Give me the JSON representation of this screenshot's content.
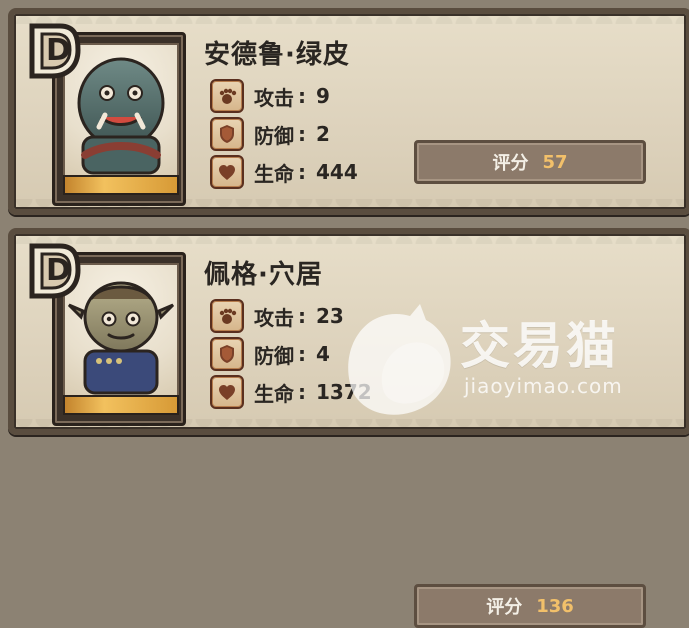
{
  "units": [
    {
      "rank": "D",
      "name": "安德鲁·绿皮",
      "stats": [
        {
          "icon": "paw-icon",
          "label": "攻击",
          "value": "9"
        },
        {
          "icon": "shield-icon",
          "label": "防御",
          "value": "2"
        },
        {
          "icon": "heart-icon",
          "label": "生命",
          "value": "444"
        }
      ],
      "score_label": "评分",
      "score_value": "57",
      "portrait_fill": 1.0
    },
    {
      "rank": "D",
      "name": "佩格·穴居",
      "stats": [
        {
          "icon": "paw-icon",
          "label": "攻击",
          "value": "23"
        },
        {
          "icon": "shield-icon",
          "label": "防御",
          "value": "4"
        },
        {
          "icon": "heart-icon",
          "label": "生命",
          "value": "1372"
        }
      ],
      "score_label": "评分",
      "score_value": "136",
      "portrait_fill": 1.0
    }
  ],
  "watermark": {
    "cn": "交易猫",
    "en": "jiaoyimao.com"
  },
  "colors": {
    "score_value": "#f2c06a",
    "score_bg": "#8c7a6a",
    "paper": "#e7dec9"
  }
}
